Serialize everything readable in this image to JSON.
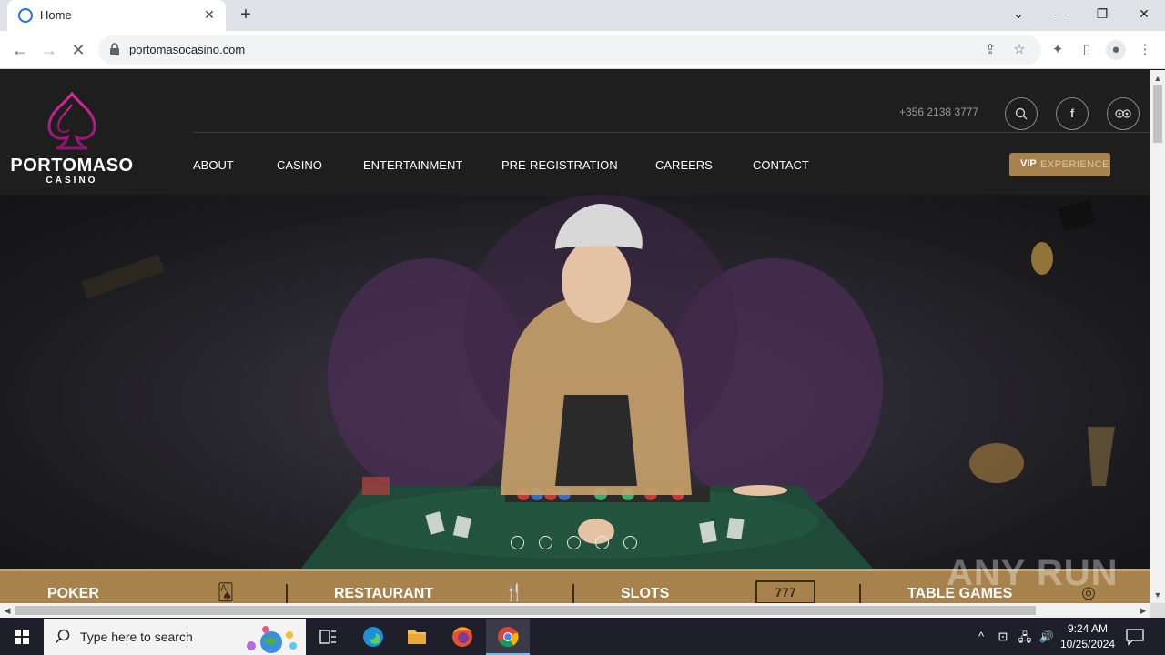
{
  "browser": {
    "tab_title": "Home",
    "url": "portomasocasino.com"
  },
  "site": {
    "brand": "PORTOMASO",
    "brand_sub": "CASINO",
    "phone": "+356 2138 3777",
    "nav": [
      "ABOUT",
      "CASINO",
      "ENTERTAINMENT",
      "PRE-REGISTRATION",
      "CAREERS",
      "CONTACT"
    ],
    "vip_bold": "VIP",
    "vip_rest": "EXPERIENCE",
    "categories": [
      "POKER",
      "RESTAURANT",
      "SLOTS",
      "TABLE GAMES"
    ],
    "slider_dots": 5
  },
  "watermark": "ANY RUN",
  "taskbar": {
    "search_placeholder": "Type here to search",
    "time": "9:24 AM",
    "date": "10/25/2024"
  },
  "colors": {
    "gold": "#a7824c",
    "spade_pink": "#c2188a",
    "header_bg": "#1e1e1e"
  }
}
